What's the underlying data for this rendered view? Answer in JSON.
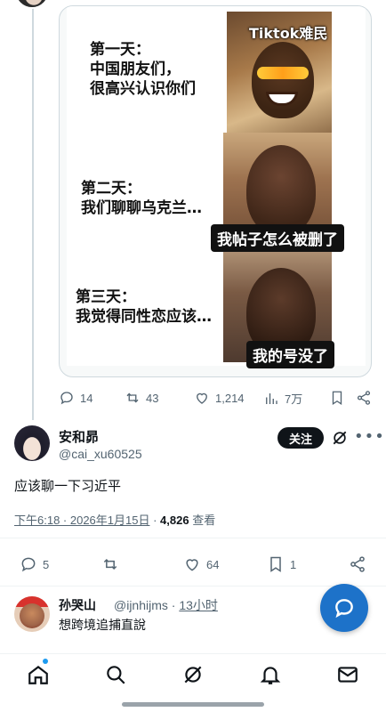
{
  "meme": {
    "watermark": "Tiktok难民",
    "panel1_text": "第一天：\n中国朋友们，\n很高兴认识你们",
    "panel2_text": "第二天：\n我们聊聊乌克兰…",
    "panel2_caption": "我帖子怎么被删了",
    "panel3_text": "第三天：\n我觉得同性恋应该…",
    "panel3_caption": "我的号没了"
  },
  "quoted_actions": {
    "replies": "14",
    "reposts": "43",
    "likes": "1,214",
    "views": "7万"
  },
  "tweet": {
    "display_name": "安和昴",
    "handle": "@cai_xu60525",
    "follow_label": "关注",
    "text": "应该聊一下习近平",
    "time": "下午6:18 · 2026年1月15日",
    "separator": " · ",
    "views_count": "4,826",
    "views_label": " 查看"
  },
  "main_actions": {
    "replies": "5",
    "likes": "64",
    "bookmarks": "1"
  },
  "reply": {
    "display_name": "孙哭山",
    "handle": "@ijnhijms · ",
    "time": "13小时",
    "text": "想跨境追捕直說"
  },
  "colors": {
    "accent": "#1d9bf0",
    "fab": "#1d72c9",
    "text": "#0f1419",
    "muted": "#536471"
  },
  "icons": [
    "reply-icon",
    "repost-icon",
    "like-icon",
    "views-icon",
    "bookmark-icon",
    "share-icon",
    "grok-icon",
    "more-icon",
    "compose-icon",
    "home-icon",
    "search-icon",
    "notifications-icon",
    "messages-icon"
  ]
}
